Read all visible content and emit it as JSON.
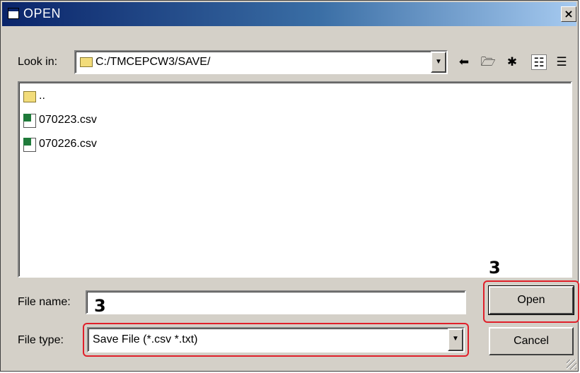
{
  "window": {
    "title": "OPEN",
    "close_glyph": "×"
  },
  "lookin": {
    "label": "Look in:",
    "path": "C:/TMCEPCW3/SAVE/",
    "toolbar_icons": [
      "back-icon",
      "up-folder-icon",
      "new-folder-icon",
      "list-view-icon",
      "details-view-icon"
    ]
  },
  "files": [
    {
      "name": "..",
      "icon": "folder-icon"
    },
    {
      "name": "070223.csv",
      "icon": "csv-file-icon"
    },
    {
      "name": "070226.csv",
      "icon": "csv-file-icon"
    }
  ],
  "filename": {
    "label": "File name:",
    "value": "",
    "step": "3"
  },
  "filetype": {
    "label": "File type:",
    "selected": "Save File (*.csv *.txt)"
  },
  "buttons": {
    "open": "Open",
    "cancel": "Cancel",
    "open_step": "3"
  },
  "colors": {
    "highlight": "#e0202a",
    "title_bar": "#0a246a",
    "dialog_bg": "#d4d0c8"
  }
}
